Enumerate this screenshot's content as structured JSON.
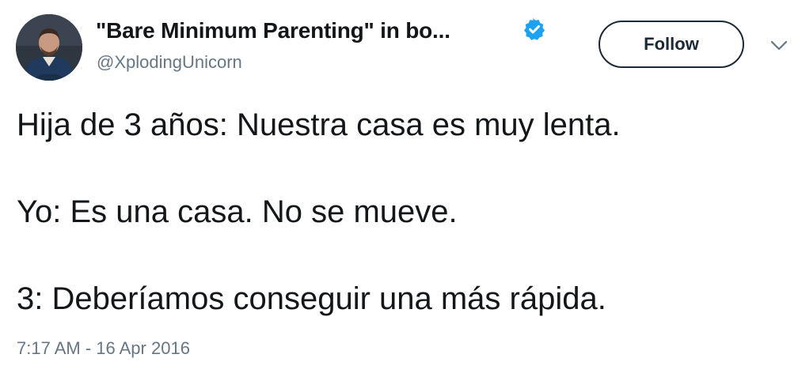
{
  "user": {
    "display_name": "\"Bare Minimum Parenting\" in bo...",
    "handle": "@XplodingUnicorn",
    "verified": true
  },
  "actions": {
    "follow_label": "Follow"
  },
  "tweet": {
    "lines": [
      "Hija de 3 años: Nuestra casa es muy lenta.",
      "Yo: Es una casa. No se mueve.",
      "3: Deberíamos conseguir una más rápida."
    ],
    "timestamp": "7:17 AM - 16 Apr 2016"
  },
  "colors": {
    "verified_blue": "#1da1f2",
    "follow_border": "#1b2836",
    "muted_text": "#657786",
    "main_text": "#14171a"
  },
  "icons": {
    "verified": "verified-badge-icon",
    "menu": "chevron-down-icon"
  }
}
